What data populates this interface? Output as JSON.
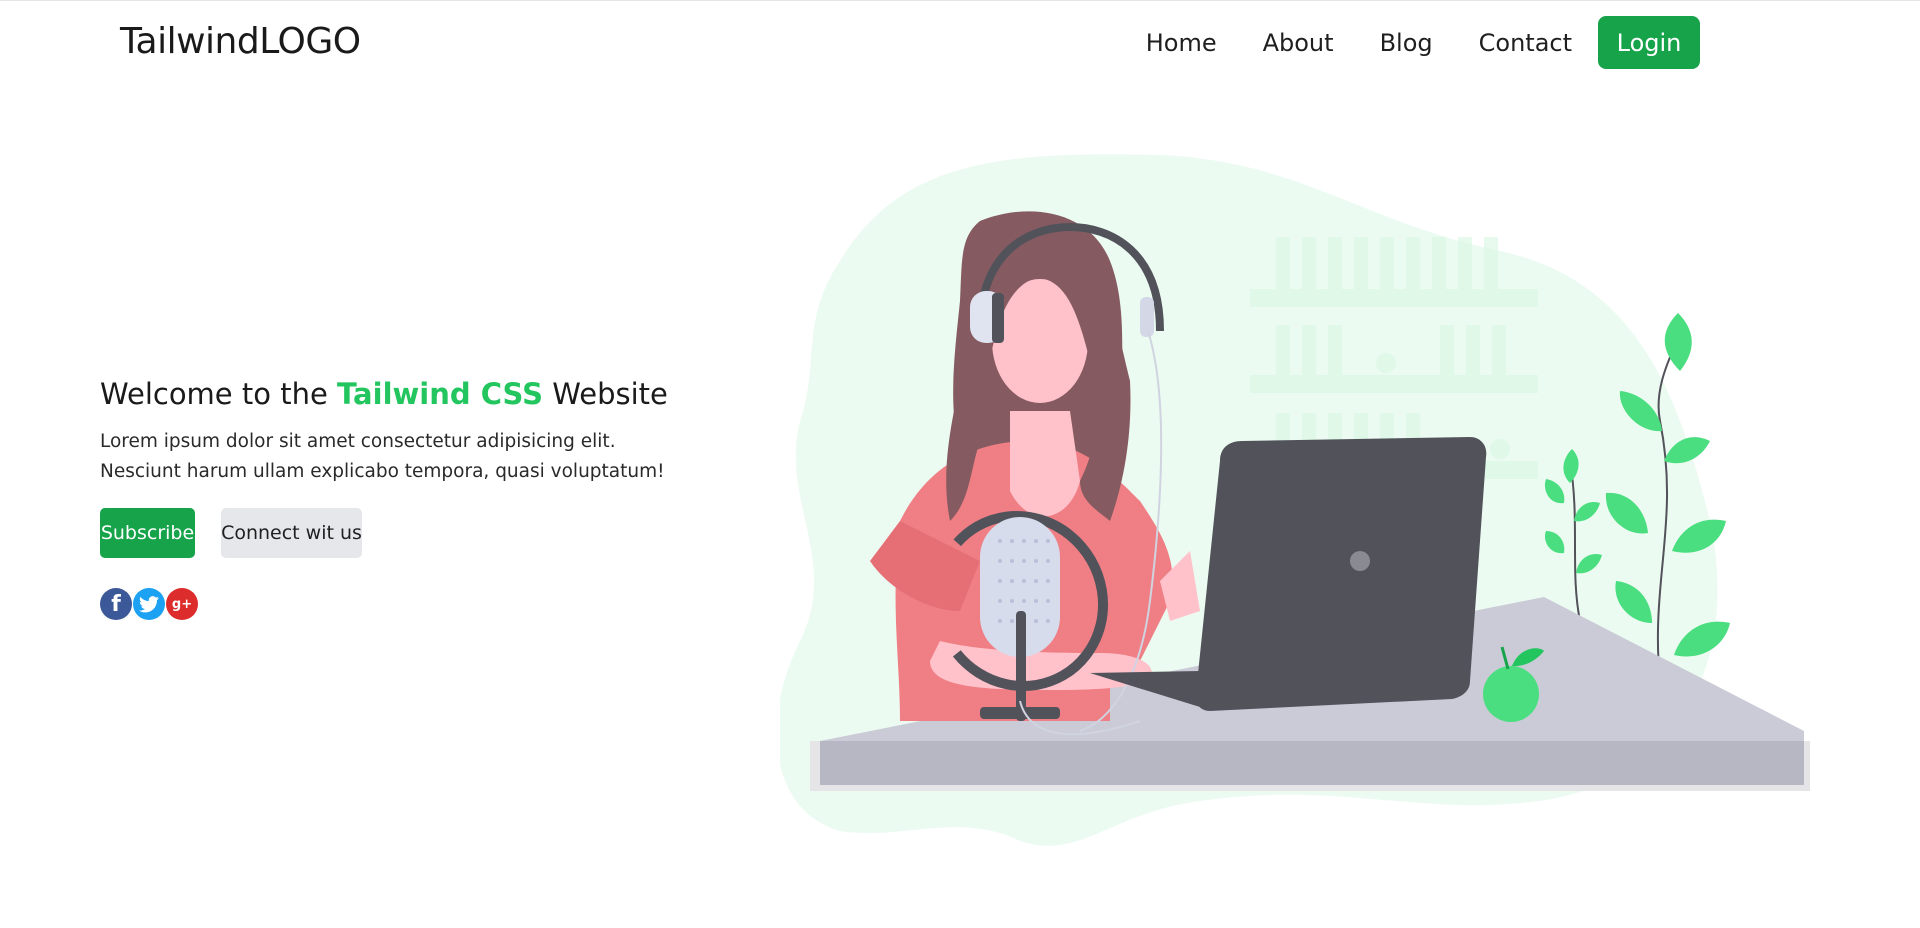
{
  "nav": {
    "logo": "TailwindLOGO",
    "links": [
      "Home",
      "About",
      "Blog",
      "Contact"
    ],
    "login_label": "Login"
  },
  "hero": {
    "title_prefix": "Welcome to the ",
    "title_accent": "Tailwind CSS",
    "title_suffix": " Website",
    "text": "Lorem ipsum dolor sit amet consectetur adipisicing elit. Nesciunt harum ullam explicabo tempora, quasi voluptatum!",
    "subscribe_label": "Subscribe",
    "connect_label": "Connect wit us",
    "social": [
      {
        "name": "facebook-icon",
        "glyph": "f"
      },
      {
        "name": "twitter-icon",
        "glyph": "t"
      },
      {
        "name": "google-plus-icon",
        "glyph": "g+"
      }
    ]
  },
  "colors": {
    "brand": "#16a34a",
    "accent": "#22c55e",
    "blob": "#eafbf0",
    "plant": "#4ade80"
  },
  "illustration": {
    "name": "podcast-illustration"
  }
}
